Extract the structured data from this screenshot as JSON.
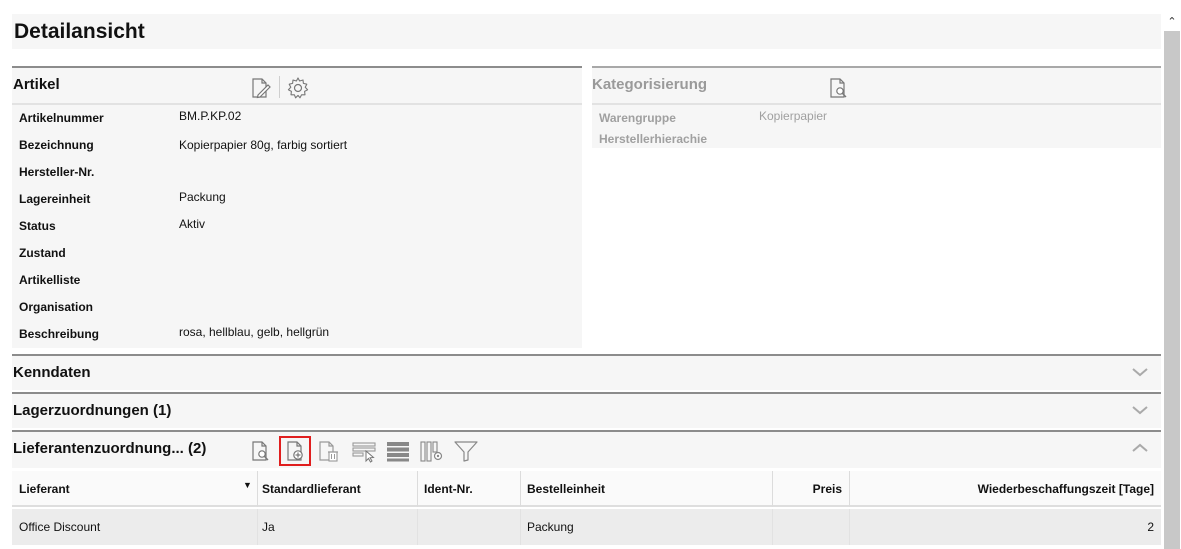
{
  "page": {
    "title": "Detailansicht"
  },
  "artikel": {
    "title": "Artikel",
    "fields": [
      {
        "label": "Artikelnummer",
        "value": "BM.P.KP.02"
      },
      {
        "label": "Bezeichnung",
        "value": "Kopierpapier 80g, farbig sortiert"
      },
      {
        "label": "Hersteller-Nr.",
        "value": ""
      },
      {
        "label": "Lagereinheit",
        "value": "Packung"
      },
      {
        "label": "Status",
        "value": "Aktiv"
      },
      {
        "label": "Zustand",
        "value": ""
      },
      {
        "label": "Artikelliste",
        "value": ""
      },
      {
        "label": "Organisation",
        "value": ""
      },
      {
        "label": "Beschreibung",
        "value": "rosa, hellblau, gelb, hellgrün"
      }
    ],
    "icons": [
      "edit-document-icon",
      "settings-gear-icon"
    ]
  },
  "kategorisierung": {
    "title": "Kategorisierung",
    "fields": [
      {
        "label": "Warengruppe",
        "value": "Kopierpapier"
      },
      {
        "label": "Herstellerhierachie",
        "value": ""
      }
    ],
    "icons": [
      "view-document-icon"
    ]
  },
  "sections": {
    "kenndaten": {
      "title": "Kenndaten",
      "state": "collapsed"
    },
    "lager": {
      "title": "Lagerzuordnungen (1)",
      "state": "collapsed"
    },
    "lieferanten": {
      "title": "Lieferantenzuordnung... (2)",
      "state": "expanded"
    }
  },
  "toolbar_icons": [
    "view-document-icon",
    "add-document-icon",
    "delete-document-icon",
    "select-rows-icon",
    "list-view-icon",
    "column-settings-icon",
    "filter-icon"
  ],
  "highlight_color": "#e01e1e",
  "grid": {
    "columns": [
      "Lieferant",
      "Standardlieferant",
      "Ident-Nr.",
      "Bestelleinheit",
      "Preis",
      "Wiederbeschaffungszeit [Tage]"
    ],
    "sorted_column": "Lieferant",
    "rows": [
      {
        "lieferant": "Office Discount",
        "standard": "Ja",
        "ident": "",
        "bestelleinheit": "Packung",
        "preis": "",
        "wbz": "2"
      }
    ]
  }
}
